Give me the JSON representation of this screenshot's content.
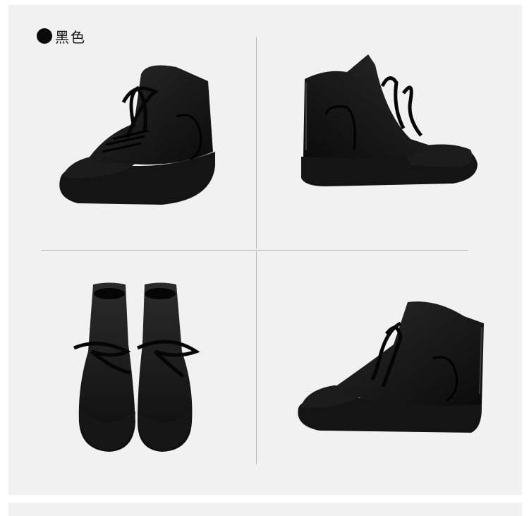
{
  "color_label": "黑色",
  "colors": {
    "background": "#f1f1f1",
    "boot": "#111111",
    "divider": "#b9b9b9"
  }
}
